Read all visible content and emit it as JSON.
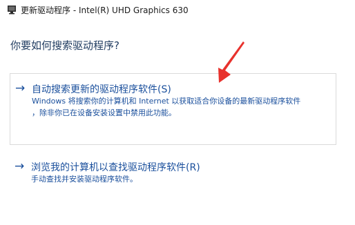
{
  "window": {
    "title": "更新驱动程序 - Intel(R) UHD Graphics 630",
    "icon": "monitor-icon"
  },
  "question": "你要如何搜索驱动程序?",
  "options": [
    {
      "arrow": "→",
      "title": "自动搜索更新的驱动程序软件(S)",
      "desc_line1": "Windows 将搜索你的计算机和 Internet 以获取适合你设备的最新驱动程序软件",
      "desc_line2": "，除非你已在设备安装设置中禁用此功能。"
    },
    {
      "arrow": "→",
      "title": "浏览我的计算机以查找驱动程序软件(R)",
      "desc_line1": "手动查找并安装驱动程序软件。"
    }
  ],
  "annotation": {
    "color": "#e8322d",
    "icon": "red-pointer-arrow"
  }
}
